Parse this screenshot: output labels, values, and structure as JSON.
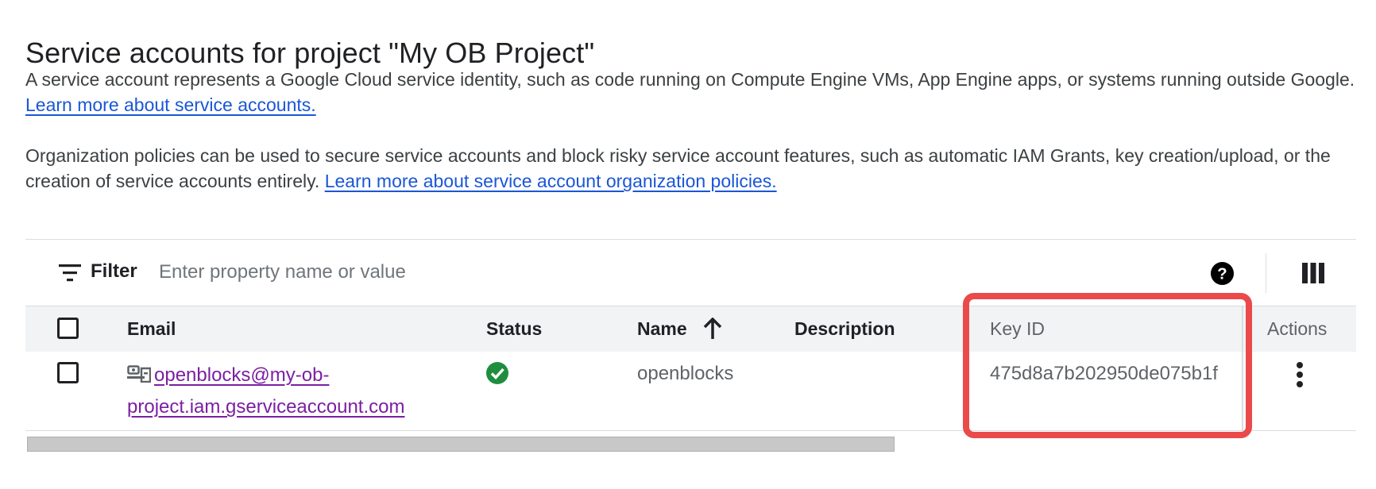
{
  "page": {
    "title": "Service accounts for project \"My OB Project\"",
    "intro_text": "A service account represents a Google Cloud service identity, such as code running on Compute Engine VMs, App Engine apps, or systems running outside Google.",
    "intro_link": "Learn more about service accounts.",
    "policy_text": "Organization policies can be used to secure service accounts and block risky service account features, such as automatic IAM Grants, key creation/upload, or the creation of service accounts entirely.",
    "policy_link": "Learn more about service account organization policies."
  },
  "toolbar": {
    "filter_label": "Filter",
    "filter_placeholder": "Enter property name or value",
    "help_icon": "help-circle-icon",
    "columns_icon": "column-display-icon"
  },
  "table": {
    "columns": {
      "email": "Email",
      "status": "Status",
      "name": "Name",
      "description": "Description",
      "key_id": "Key ID",
      "actions": "Actions"
    },
    "sort": {
      "column": "Name",
      "direction": "ascending",
      "icon": "arrow-up-icon"
    },
    "rows": [
      {
        "email": "openblocks@my-ob-project.iam.gserviceaccount.com",
        "email_icon": "service-account-icon",
        "status": "enabled",
        "status_icon": "check-circle-icon",
        "status_color": "#1e8e3e",
        "name": "openblocks",
        "description": "",
        "key_id": "475d8a7b202950de075b1f",
        "actions_icon": "more-vert-icon"
      }
    ]
  },
  "annotation": {
    "highlight_color": "#ea4a4a",
    "highlighted_column": "Key ID"
  },
  "colors": {
    "link": "#1a56d6",
    "visited_link": "#7b1fa2",
    "header_bg": "#f1f3f4",
    "border": "#dadce0"
  }
}
